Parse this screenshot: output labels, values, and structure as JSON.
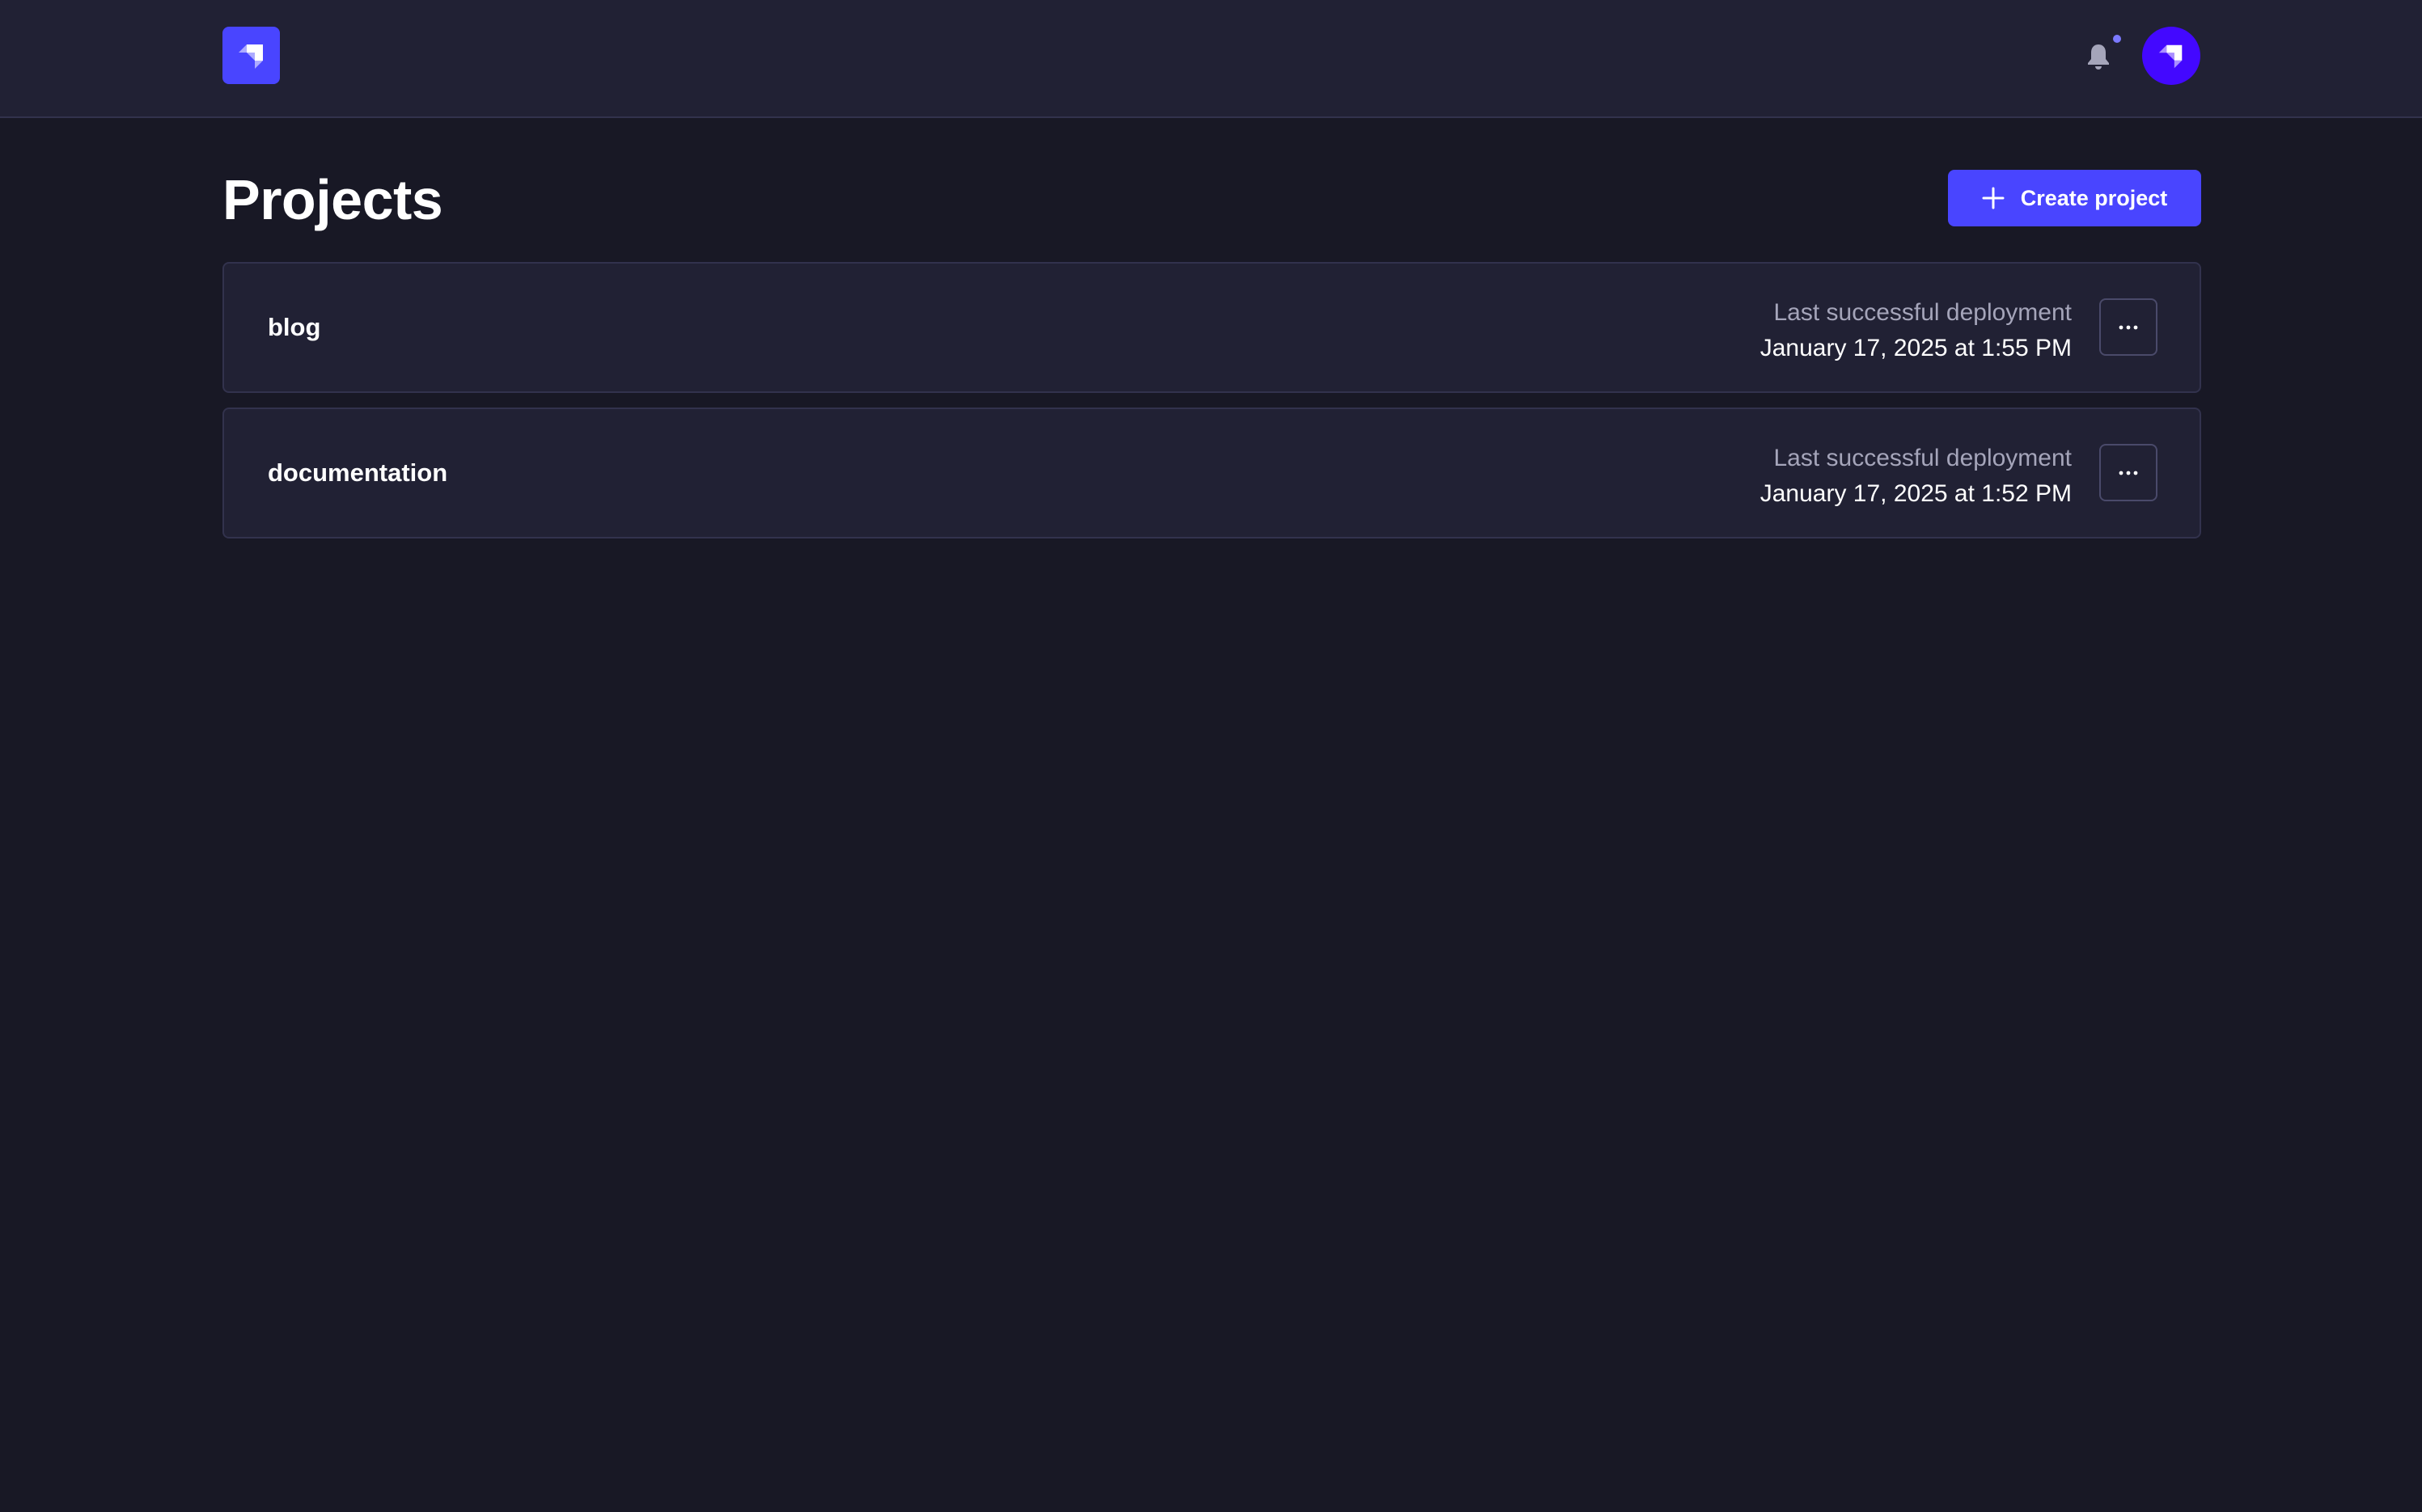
{
  "header": {
    "logo_icon": "strapi-logo-icon",
    "notifications_icon": "bell-icon",
    "avatar_icon": "strapi-logo-icon"
  },
  "main": {
    "title": "Projects",
    "create_button_label": "Create project",
    "create_button_icon": "plus-icon"
  },
  "projects": [
    {
      "name": "blog",
      "deploy_label": "Last successful deployment",
      "deploy_date": "January 17, 2025 at 1:55 PM",
      "menu_icon": "ellipsis-icon"
    },
    {
      "name": "documentation",
      "deploy_label": "Last successful deployment",
      "deploy_date": "January 17, 2025 at 1:52 PM",
      "menu_icon": "ellipsis-icon"
    }
  ],
  "colors": {
    "accent": "#4945ff",
    "background": "#181825",
    "surface": "#212134",
    "border": "#32324d",
    "muted_text": "#a5a5ba"
  }
}
